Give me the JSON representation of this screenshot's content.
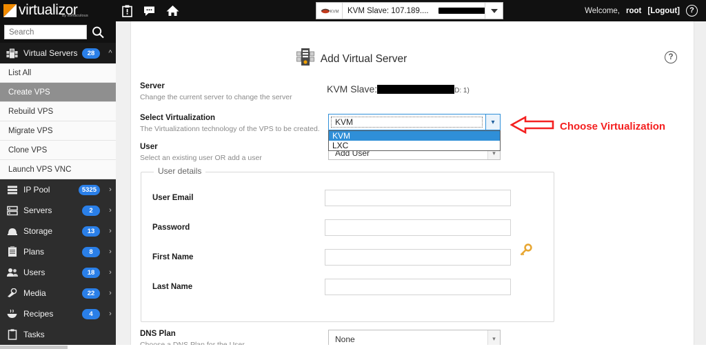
{
  "app": {
    "brand_name": "virtualizor",
    "brand_tagline": "by softaculous",
    "accent_orange": "#f08a00",
    "accent_blue": "#2a7fe8",
    "annotation_red": "#f42020"
  },
  "topbar": {
    "icons": [
      {
        "name": "tasks-clipboard-icon",
        "glyph": "clipboard"
      },
      {
        "name": "messages-icon",
        "glyph": "chat-bubble"
      },
      {
        "name": "home-icon",
        "glyph": "house"
      }
    ],
    "server_switcher": {
      "label": "KVM Slave: 107.189....",
      "secondary_redacted": true,
      "logo_alt": "KVM"
    },
    "welcome_text": "Welcome,",
    "user": "root",
    "logout": "[Logout]",
    "help": "?"
  },
  "sidebar": {
    "search": {
      "placeholder": "Search",
      "value": ""
    },
    "groups": [
      {
        "label": "Virtual Servers",
        "badge": "28",
        "icon": "servers-stack-icon",
        "expanded": true,
        "items": [
          {
            "label": "List All",
            "active": false
          },
          {
            "label": "Create VPS",
            "active": true
          },
          {
            "label": "Rebuild VPS",
            "active": false
          },
          {
            "label": "Migrate VPS",
            "active": false
          },
          {
            "label": "Clone VPS",
            "active": false
          },
          {
            "label": "Launch VPS VNC",
            "active": false
          }
        ]
      },
      {
        "label": "IP Pool",
        "badge": "5325",
        "icon": "ip-pool-icon",
        "expanded": false,
        "items": []
      },
      {
        "label": "Servers",
        "badge": "2",
        "icon": "server-icon",
        "expanded": false,
        "items": []
      },
      {
        "label": "Storage",
        "badge": "13",
        "icon": "storage-icon",
        "expanded": false,
        "items": []
      },
      {
        "label": "Plans",
        "badge": "8",
        "icon": "plans-icon",
        "expanded": false,
        "items": []
      },
      {
        "label": "Users",
        "badge": "18",
        "icon": "users-icon",
        "expanded": false,
        "items": []
      },
      {
        "label": "Media",
        "badge": "22",
        "icon": "media-icon",
        "expanded": false,
        "items": []
      },
      {
        "label": "Recipes",
        "badge": "4",
        "icon": "recipes-icon",
        "expanded": false,
        "items": []
      },
      {
        "label": "Tasks",
        "badge": "",
        "icon": "tasks-icon",
        "expanded": false,
        "items": []
      }
    ]
  },
  "main": {
    "title": "Add Virtual Server",
    "help": "?",
    "server": {
      "label": "Server",
      "description": "Change the current server to change the server",
      "value_prefix": "KVM Slave:",
      "value_redacted": true,
      "value_suffix": "D: 1)"
    },
    "virtualization": {
      "label": "Select Virtualization",
      "description": "The Virtualizationn technology of the VPS to be created.",
      "selected": "KVM",
      "options": [
        "KVM",
        "LXC"
      ],
      "open": true
    },
    "user": {
      "label": "User",
      "description": "Select an existing user OR add a user",
      "selected": "Add User"
    },
    "user_details": {
      "legend": "User details",
      "fields": [
        {
          "label": "User Email",
          "value": "",
          "type": "text"
        },
        {
          "label": "Password",
          "value": "",
          "type": "password",
          "side_icon": "key-icon"
        },
        {
          "label": "First Name",
          "value": "",
          "type": "text"
        },
        {
          "label": "Last Name",
          "value": "",
          "type": "text"
        }
      ]
    },
    "dns_plan": {
      "label": "DNS Plan",
      "description": "Choose a DNS Plan for the User",
      "selected": "None"
    }
  },
  "annotation": {
    "text": "Choose Virtualization",
    "arrow": "left-arrow-icon"
  }
}
